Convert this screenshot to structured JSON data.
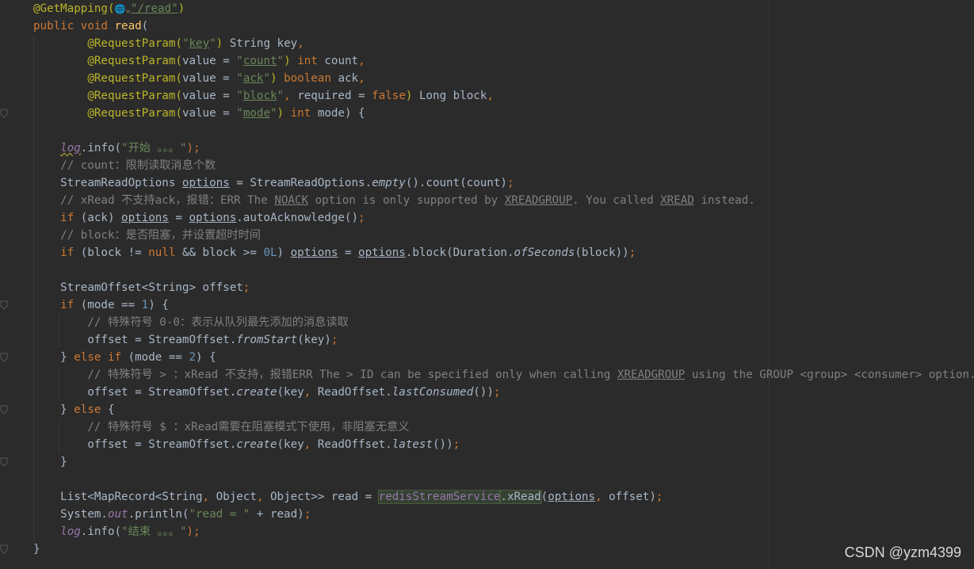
{
  "colors": {
    "background": "#2b2b2b",
    "keyword": "#cc7832",
    "annotation": "#bbb529",
    "string": "#6a8759",
    "number": "#6897bb",
    "comment": "#808080",
    "field": "#9876aa",
    "method": "#ffc66d",
    "plain": "#a9b7c6"
  },
  "code_lines": [
    [
      {
        "t": "@GetMapping(",
        "c": "annotation"
      },
      {
        "t": "🌐⌄",
        "c": "comment",
        "icon": "globe-icon"
      },
      {
        "t": "\"/read\"",
        "c": "string",
        "u": true
      },
      {
        "t": ")",
        "c": "annotation"
      }
    ],
    [
      {
        "t": "public void ",
        "c": "keyword"
      },
      {
        "t": "read",
        "c": "method"
      },
      {
        "t": "(",
        "c": "plain"
      }
    ],
    [
      {
        "t": "        ",
        "c": "plain"
      },
      {
        "t": "@RequestParam(",
        "c": "annotation"
      },
      {
        "t": "\"",
        "c": "string"
      },
      {
        "t": "key",
        "c": "string",
        "u": true
      },
      {
        "t": "\"",
        "c": "string"
      },
      {
        "t": ") ",
        "c": "annotation"
      },
      {
        "t": "String key",
        "c": "plain"
      },
      {
        "t": ",",
        "c": "keyword"
      }
    ],
    [
      {
        "t": "        ",
        "c": "plain"
      },
      {
        "t": "@RequestParam(",
        "c": "annotation"
      },
      {
        "t": "value = ",
        "c": "plain"
      },
      {
        "t": "\"",
        "c": "string"
      },
      {
        "t": "count",
        "c": "string",
        "u": true
      },
      {
        "t": "\"",
        "c": "string"
      },
      {
        "t": ") ",
        "c": "annotation"
      },
      {
        "t": "int ",
        "c": "keyword"
      },
      {
        "t": "count",
        "c": "plain"
      },
      {
        "t": ",",
        "c": "keyword"
      }
    ],
    [
      {
        "t": "        ",
        "c": "plain"
      },
      {
        "t": "@RequestParam(",
        "c": "annotation"
      },
      {
        "t": "value = ",
        "c": "plain"
      },
      {
        "t": "\"",
        "c": "string"
      },
      {
        "t": "ack",
        "c": "string",
        "u": true
      },
      {
        "t": "\"",
        "c": "string"
      },
      {
        "t": ") ",
        "c": "annotation"
      },
      {
        "t": "boolean ",
        "c": "keyword"
      },
      {
        "t": "ack",
        "c": "plain"
      },
      {
        "t": ",",
        "c": "keyword"
      }
    ],
    [
      {
        "t": "        ",
        "c": "plain"
      },
      {
        "t": "@RequestParam(",
        "c": "annotation"
      },
      {
        "t": "value = ",
        "c": "plain"
      },
      {
        "t": "\"",
        "c": "string"
      },
      {
        "t": "block",
        "c": "string",
        "u": true
      },
      {
        "t": "\"",
        "c": "string"
      },
      {
        "t": ", ",
        "c": "keyword"
      },
      {
        "t": "required = ",
        "c": "plain"
      },
      {
        "t": "false",
        "c": "keyword"
      },
      {
        "t": ") ",
        "c": "annotation"
      },
      {
        "t": "Long block",
        "c": "plain"
      },
      {
        "t": ",",
        "c": "keyword"
      }
    ],
    [
      {
        "t": "        ",
        "c": "plain"
      },
      {
        "t": "@RequestParam(",
        "c": "annotation"
      },
      {
        "t": "value = ",
        "c": "plain"
      },
      {
        "t": "\"",
        "c": "string"
      },
      {
        "t": "mode",
        "c": "string",
        "u": true
      },
      {
        "t": "\"",
        "c": "string"
      },
      {
        "t": ") ",
        "c": "annotation"
      },
      {
        "t": "int ",
        "c": "keyword"
      },
      {
        "t": "mode) {",
        "c": "plain"
      }
    ],
    [],
    [
      {
        "t": "    ",
        "c": "plain"
      },
      {
        "t": "log",
        "c": "field",
        "i": true,
        "w": true
      },
      {
        "t": ".info(",
        "c": "plain"
      },
      {
        "t": "\"开始 。。。\"",
        "c": "string"
      },
      {
        "t": ");",
        "c": "keyword"
      }
    ],
    [
      {
        "t": "    // count：限制读取消息个数",
        "c": "comment"
      }
    ],
    [
      {
        "t": "    StreamReadOptions ",
        "c": "plain"
      },
      {
        "t": "options",
        "c": "plain",
        "u": true
      },
      {
        "t": " = StreamReadOptions.",
        "c": "plain"
      },
      {
        "t": "empty",
        "c": "plain",
        "i": true
      },
      {
        "t": "().count(count)",
        "c": "plain"
      },
      {
        "t": ";",
        "c": "keyword"
      }
    ],
    [
      {
        "t": "    // xRead 不支持ack，报错：ERR The ",
        "c": "comment"
      },
      {
        "t": "NOACK",
        "c": "comment",
        "u": true
      },
      {
        "t": " option is only supported by ",
        "c": "comment"
      },
      {
        "t": "XREADGROUP",
        "c": "comment",
        "u": true
      },
      {
        "t": ". You called ",
        "c": "comment"
      },
      {
        "t": "XREAD",
        "c": "comment",
        "u": true
      },
      {
        "t": " instead.",
        "c": "comment"
      }
    ],
    [
      {
        "t": "    ",
        "c": "plain"
      },
      {
        "t": "if ",
        "c": "keyword"
      },
      {
        "t": "(ack) ",
        "c": "plain"
      },
      {
        "t": "options",
        "c": "plain",
        "u": true
      },
      {
        "t": " = ",
        "c": "plain"
      },
      {
        "t": "options",
        "c": "plain",
        "u": true
      },
      {
        "t": ".autoAcknowledge()",
        "c": "plain"
      },
      {
        "t": ";",
        "c": "keyword"
      }
    ],
    [
      {
        "t": "    // block：是否阻塞，并设置超时时间",
        "c": "comment"
      }
    ],
    [
      {
        "t": "    ",
        "c": "plain"
      },
      {
        "t": "if ",
        "c": "keyword"
      },
      {
        "t": "(block != ",
        "c": "plain"
      },
      {
        "t": "null ",
        "c": "keyword"
      },
      {
        "t": "&& block >= ",
        "c": "plain"
      },
      {
        "t": "0L",
        "c": "number"
      },
      {
        "t": ") ",
        "c": "plain"
      },
      {
        "t": "options",
        "c": "plain",
        "u": true
      },
      {
        "t": " = ",
        "c": "plain"
      },
      {
        "t": "options",
        "c": "plain",
        "u": true
      },
      {
        "t": ".block(Duration.",
        "c": "plain"
      },
      {
        "t": "ofSeconds",
        "c": "plain",
        "i": true
      },
      {
        "t": "(block))",
        "c": "plain"
      },
      {
        "t": ";",
        "c": "keyword"
      }
    ],
    [],
    [
      {
        "t": "    StreamOffset<String> offset",
        "c": "plain"
      },
      {
        "t": ";",
        "c": "keyword"
      }
    ],
    [
      {
        "t": "    ",
        "c": "plain"
      },
      {
        "t": "if ",
        "c": "keyword"
      },
      {
        "t": "(mode == ",
        "c": "plain"
      },
      {
        "t": "1",
        "c": "number"
      },
      {
        "t": ") {",
        "c": "plain"
      }
    ],
    [
      {
        "t": "        // 特殊符号 0-0：表示从队列最先添加的消息读取",
        "c": "comment"
      }
    ],
    [
      {
        "t": "        offset = StreamOffset.",
        "c": "plain"
      },
      {
        "t": "fromStart",
        "c": "plain",
        "i": true
      },
      {
        "t": "(key)",
        "c": "plain"
      },
      {
        "t": ";",
        "c": "keyword"
      }
    ],
    [
      {
        "t": "    } ",
        "c": "plain"
      },
      {
        "t": "else if ",
        "c": "keyword"
      },
      {
        "t": "(mode == ",
        "c": "plain"
      },
      {
        "t": "2",
        "c": "number"
      },
      {
        "t": ") {",
        "c": "plain"
      }
    ],
    [
      {
        "t": "        // 特殊符号 > ：xRead 不支持，报错ERR The > ID can be specified only when calling ",
        "c": "comment"
      },
      {
        "t": "XREADGROUP",
        "c": "comment",
        "u": true
      },
      {
        "t": " using the GROUP <group> <consumer> option.",
        "c": "comment"
      }
    ],
    [
      {
        "t": "        offset = StreamOffset.",
        "c": "plain"
      },
      {
        "t": "create",
        "c": "plain",
        "i": true
      },
      {
        "t": "(key",
        "c": "plain"
      },
      {
        "t": ", ",
        "c": "keyword"
      },
      {
        "t": "ReadOffset.",
        "c": "plain"
      },
      {
        "t": "lastConsumed",
        "c": "plain",
        "i": true
      },
      {
        "t": "())",
        "c": "plain"
      },
      {
        "t": ";",
        "c": "keyword"
      }
    ],
    [
      {
        "t": "    } ",
        "c": "plain"
      },
      {
        "t": "else ",
        "c": "keyword"
      },
      {
        "t": "{",
        "c": "plain"
      }
    ],
    [
      {
        "t": "        // 特殊符号 $ ：xRead需要在阻塞模式下使用，非阻塞无意义",
        "c": "comment"
      }
    ],
    [
      {
        "t": "        offset = StreamOffset.",
        "c": "plain"
      },
      {
        "t": "create",
        "c": "plain",
        "i": true
      },
      {
        "t": "(key",
        "c": "plain"
      },
      {
        "t": ", ",
        "c": "keyword"
      },
      {
        "t": "ReadOffset.",
        "c": "plain"
      },
      {
        "t": "latest",
        "c": "plain",
        "i": true
      },
      {
        "t": "())",
        "c": "plain"
      },
      {
        "t": ";",
        "c": "keyword"
      }
    ],
    [
      {
        "t": "    }",
        "c": "plain"
      }
    ],
    [],
    [
      {
        "t": "    List<MapRecord<String",
        "c": "plain"
      },
      {
        "t": ", ",
        "c": "keyword"
      },
      {
        "t": "Object",
        "c": "plain"
      },
      {
        "t": ", ",
        "c": "keyword"
      },
      {
        "t": "Object>> read = ",
        "c": "plain"
      },
      {
        "t": "redisStreamService",
        "c": "field",
        "hl": true
      },
      {
        "t": ".xRead",
        "c": "plain",
        "hl": true
      },
      {
        "t": "(",
        "c": "plain"
      },
      {
        "t": "options",
        "c": "plain",
        "u": true
      },
      {
        "t": ", ",
        "c": "keyword"
      },
      {
        "t": "offset)",
        "c": "plain"
      },
      {
        "t": ";",
        "c": "keyword"
      }
    ],
    [
      {
        "t": "    System.",
        "c": "plain"
      },
      {
        "t": "out",
        "c": "field",
        "i": true
      },
      {
        "t": ".println(",
        "c": "plain"
      },
      {
        "t": "\"read = \" ",
        "c": "string"
      },
      {
        "t": "+ read)",
        "c": "plain"
      },
      {
        "t": ";",
        "c": "keyword"
      }
    ],
    [
      {
        "t": "    ",
        "c": "plain"
      },
      {
        "t": "log",
        "c": "field",
        "i": true
      },
      {
        "t": ".info(",
        "c": "plain"
      },
      {
        "t": "\"结束 。。。\"",
        "c": "string"
      },
      {
        "t": ");",
        "c": "keyword"
      }
    ],
    [
      {
        "t": "}",
        "c": "plain"
      }
    ]
  ],
  "watermark": "CSDN @yzm4399"
}
